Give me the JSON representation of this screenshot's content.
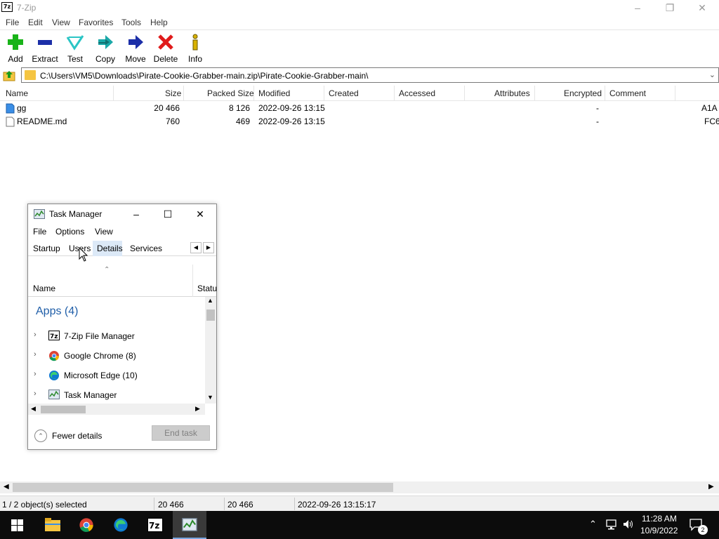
{
  "window": {
    "title": "7-Zip",
    "minimize": "–",
    "restore": "❐",
    "close": "✕"
  },
  "menu": [
    "File",
    "Edit",
    "View",
    "Favorites",
    "Tools",
    "Help"
  ],
  "toolbar": [
    "Add",
    "Extract",
    "Test",
    "Copy",
    "Move",
    "Delete",
    "Info"
  ],
  "address": {
    "path": "C:\\Users\\VM5\\Downloads\\Pirate-Cookie-Grabber-main.zip\\Pirate-Cookie-Grabber-main\\"
  },
  "columns": [
    "Name",
    "Size",
    "Packed Size",
    "Modified",
    "Created",
    "Accessed",
    "Attributes",
    "Encrypted",
    "Comment"
  ],
  "files": [
    {
      "name": "gg",
      "size": "20 466",
      "packed": "8 126",
      "modified": "2022-09-26 13:15",
      "encrypted": "-",
      "crc": "A1A"
    },
    {
      "name": "README.md",
      "size": "760",
      "packed": "469",
      "modified": "2022-09-26 13:15",
      "encrypted": "-",
      "crc": "FC6"
    }
  ],
  "status": {
    "selected": "1 / 2 object(s) selected",
    "size": "20 466",
    "packed": "20 466",
    "modified": "2022-09-26 13:15:17"
  },
  "task_manager": {
    "title": "Task Manager",
    "menu": [
      "File",
      "Options",
      "View"
    ],
    "tabs": [
      "Startup",
      "Users",
      "Details",
      "Services"
    ],
    "col_name": "Name",
    "col_status": "Statu",
    "group": "Apps (4)",
    "apps": [
      "7-Zip File Manager",
      "Google Chrome (8)",
      "Microsoft Edge (10)",
      "Task Manager"
    ],
    "fewer_details": "Fewer details",
    "end_task": "End task"
  },
  "taskbar": {
    "time": "11:28 AM",
    "date": "10/9/2022",
    "notif_count": "2"
  },
  "colors": {
    "accent": "#1f5ea8",
    "taskbar": "#0c0c0c",
    "details_tab": "#dce9f7"
  }
}
